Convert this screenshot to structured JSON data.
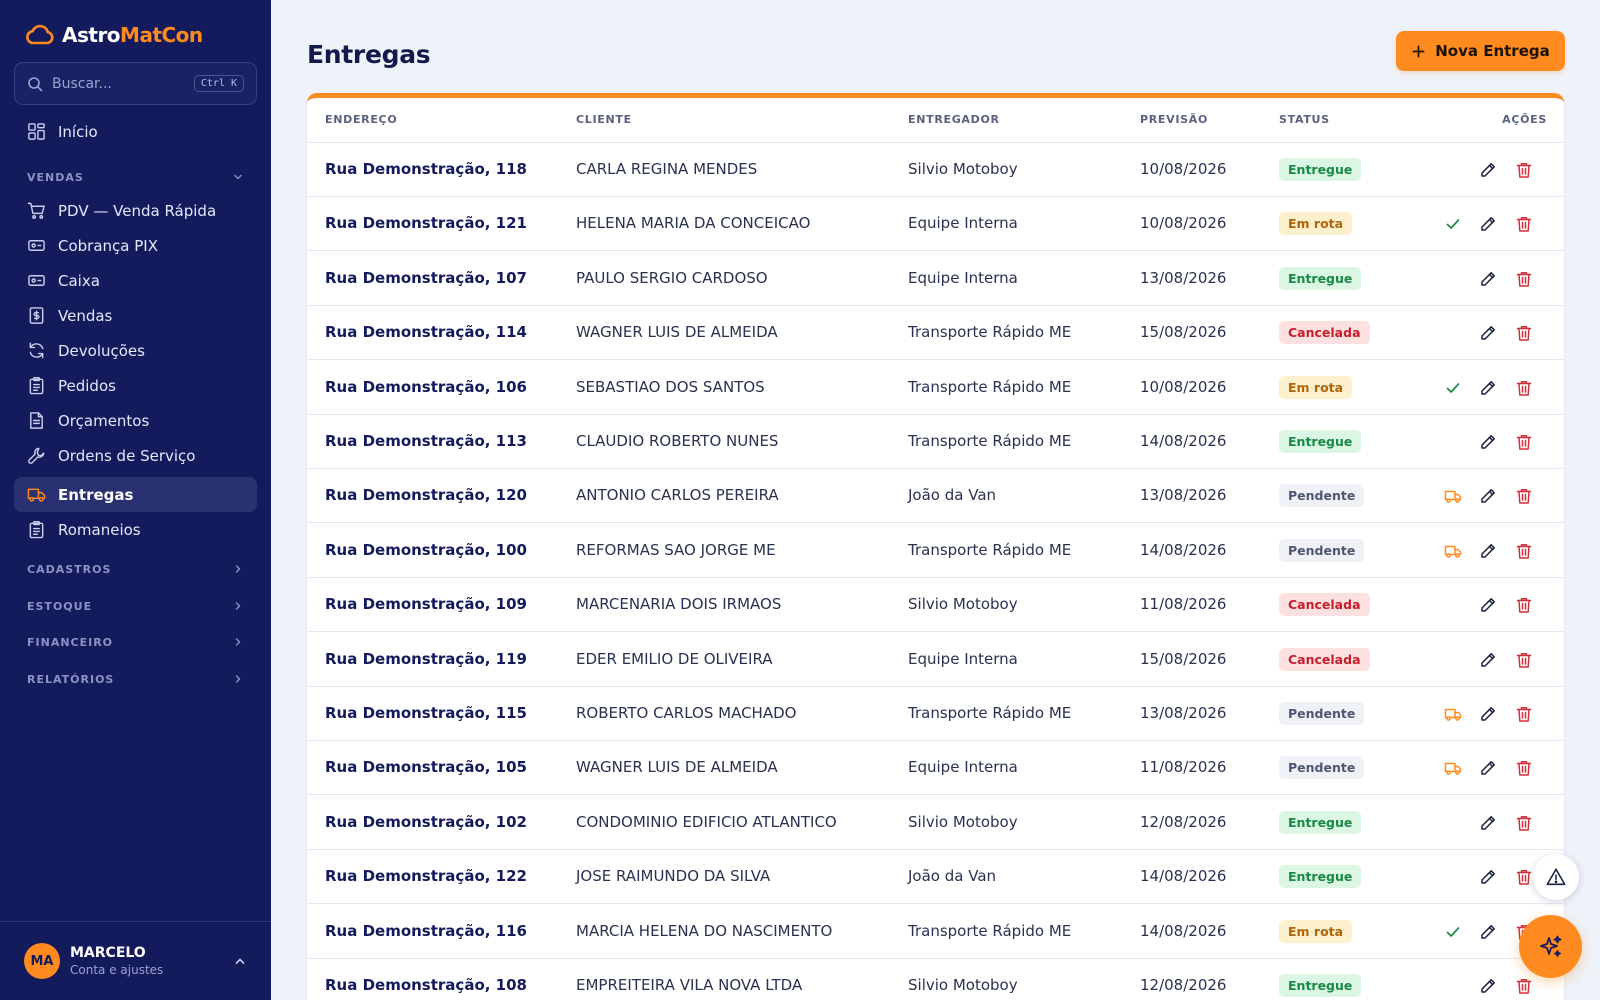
{
  "brand": {
    "part1": "Astro",
    "part2": "MatCon",
    "logo_icon": "cloud-logo-icon"
  },
  "search": {
    "placeholder": "Buscar...",
    "shortcut": "Ctrl K"
  },
  "sidebar": {
    "home": "Início",
    "sections": {
      "vendas": "VENDAS",
      "cadastros": "CADASTROS",
      "estoque": "ESTOQUE",
      "financeiro": "FINANCEIRO",
      "relatorios": "RELATÓRIOS"
    },
    "items": [
      {
        "label": "PDV — Venda Rápida",
        "icon": "cart-icon"
      },
      {
        "label": "Cobrança PIX",
        "icon": "card-icon"
      },
      {
        "label": "Caixa",
        "icon": "cash-register-icon"
      },
      {
        "label": "Vendas",
        "icon": "dollar-receipt-icon"
      },
      {
        "label": "Devoluções",
        "icon": "refresh-icon"
      },
      {
        "label": "Pedidos",
        "icon": "clipboard-icon"
      },
      {
        "label": "Orçamentos",
        "icon": "document-icon"
      },
      {
        "label": "Ordens de Serviço",
        "icon": "wrench-icon"
      },
      {
        "label": "Entregas",
        "icon": "truck-icon",
        "active": true
      },
      {
        "label": "Romaneios",
        "icon": "clipboard-list-icon"
      }
    ]
  },
  "user": {
    "initials": "MA",
    "name": "MARCELO",
    "subtitle": "Conta e ajustes"
  },
  "page": {
    "title": "Entregas",
    "new_button": "Nova Entrega"
  },
  "table": {
    "columns": {
      "address": "ENDEREÇO",
      "client": "CLIENTE",
      "driver": "ENTREGADOR",
      "forecast": "PREVISÃO",
      "status": "STATUS",
      "actions": "AÇÕES"
    },
    "rows": [
      {
        "address": "Rua Demonstração, 118",
        "client": "CARLA REGINA MENDES",
        "driver": "Silvio Motoboy",
        "date": "10/08/2026",
        "status": "Entregue",
        "status_key": "entregue"
      },
      {
        "address": "Rua Demonstração, 121",
        "client": "HELENA MARIA DA CONCEICAO",
        "driver": "Equipe Interna",
        "date": "10/08/2026",
        "status": "Em rota",
        "status_key": "emrota"
      },
      {
        "address": "Rua Demonstração, 107",
        "client": "PAULO SERGIO CARDOSO",
        "driver": "Equipe Interna",
        "date": "13/08/2026",
        "status": "Entregue",
        "status_key": "entregue"
      },
      {
        "address": "Rua Demonstração, 114",
        "client": "WAGNER LUIS DE ALMEIDA",
        "driver": "Transporte Rápido ME",
        "date": "15/08/2026",
        "status": "Cancelada",
        "status_key": "cancelada"
      },
      {
        "address": "Rua Demonstração, 106",
        "client": "SEBASTIAO DOS SANTOS",
        "driver": "Transporte Rápido ME",
        "date": "10/08/2026",
        "status": "Em rota",
        "status_key": "emrota"
      },
      {
        "address": "Rua Demonstração, 113",
        "client": "CLAUDIO ROBERTO NUNES",
        "driver": "Transporte Rápido ME",
        "date": "14/08/2026",
        "status": "Entregue",
        "status_key": "entregue"
      },
      {
        "address": "Rua Demonstração, 120",
        "client": "ANTONIO CARLOS PEREIRA",
        "driver": "João da Van",
        "date": "13/08/2026",
        "status": "Pendente",
        "status_key": "pendente"
      },
      {
        "address": "Rua Demonstração, 100",
        "client": "REFORMAS SAO JORGE ME",
        "driver": "Transporte Rápido ME",
        "date": "14/08/2026",
        "status": "Pendente",
        "status_key": "pendente"
      },
      {
        "address": "Rua Demonstração, 109",
        "client": "MARCENARIA DOIS IRMAOS",
        "driver": "Silvio Motoboy",
        "date": "11/08/2026",
        "status": "Cancelada",
        "status_key": "cancelada"
      },
      {
        "address": "Rua Demonstração, 119",
        "client": "EDER EMILIO DE OLIVEIRA",
        "driver": "Equipe Interna",
        "date": "15/08/2026",
        "status": "Cancelada",
        "status_key": "cancelada"
      },
      {
        "address": "Rua Demonstração, 115",
        "client": "ROBERTO CARLOS MACHADO",
        "driver": "Transporte Rápido ME",
        "date": "13/08/2026",
        "status": "Pendente",
        "status_key": "pendente"
      },
      {
        "address": "Rua Demonstração, 105",
        "client": "WAGNER LUIS DE ALMEIDA",
        "driver": "Equipe Interna",
        "date": "11/08/2026",
        "status": "Pendente",
        "status_key": "pendente"
      },
      {
        "address": "Rua Demonstração, 102",
        "client": "CONDOMINIO EDIFICIO ATLANTICO",
        "driver": "Silvio Motoboy",
        "date": "12/08/2026",
        "status": "Entregue",
        "status_key": "entregue"
      },
      {
        "address": "Rua Demonstração, 122",
        "client": "JOSE RAIMUNDO DA SILVA",
        "driver": "João da Van",
        "date": "14/08/2026",
        "status": "Entregue",
        "status_key": "entregue"
      },
      {
        "address": "Rua Demonstração, 116",
        "client": "MARCIA HELENA DO NASCIMENTO",
        "driver": "Transporte Rápido ME",
        "date": "14/08/2026",
        "status": "Em rota",
        "status_key": "emrota"
      },
      {
        "address": "Rua Demonstração, 108",
        "client": "EMPREITEIRA VILA NOVA LTDA",
        "driver": "Silvio Motoboy",
        "date": "12/08/2026",
        "status": "Entregue",
        "status_key": "entregue"
      }
    ]
  },
  "colors": {
    "sidebar_bg": "#141b5c",
    "accent": "#ff8a1f",
    "page_bg": "#eef2f9",
    "entregue": "#178a45",
    "em_rota": "#b0650a",
    "cancelada": "#c61e2c",
    "pendente": "#4e5672"
  },
  "floating": {
    "alert_icon": "warning-triangle-icon",
    "assistant_icon": "sparkles-icon"
  }
}
